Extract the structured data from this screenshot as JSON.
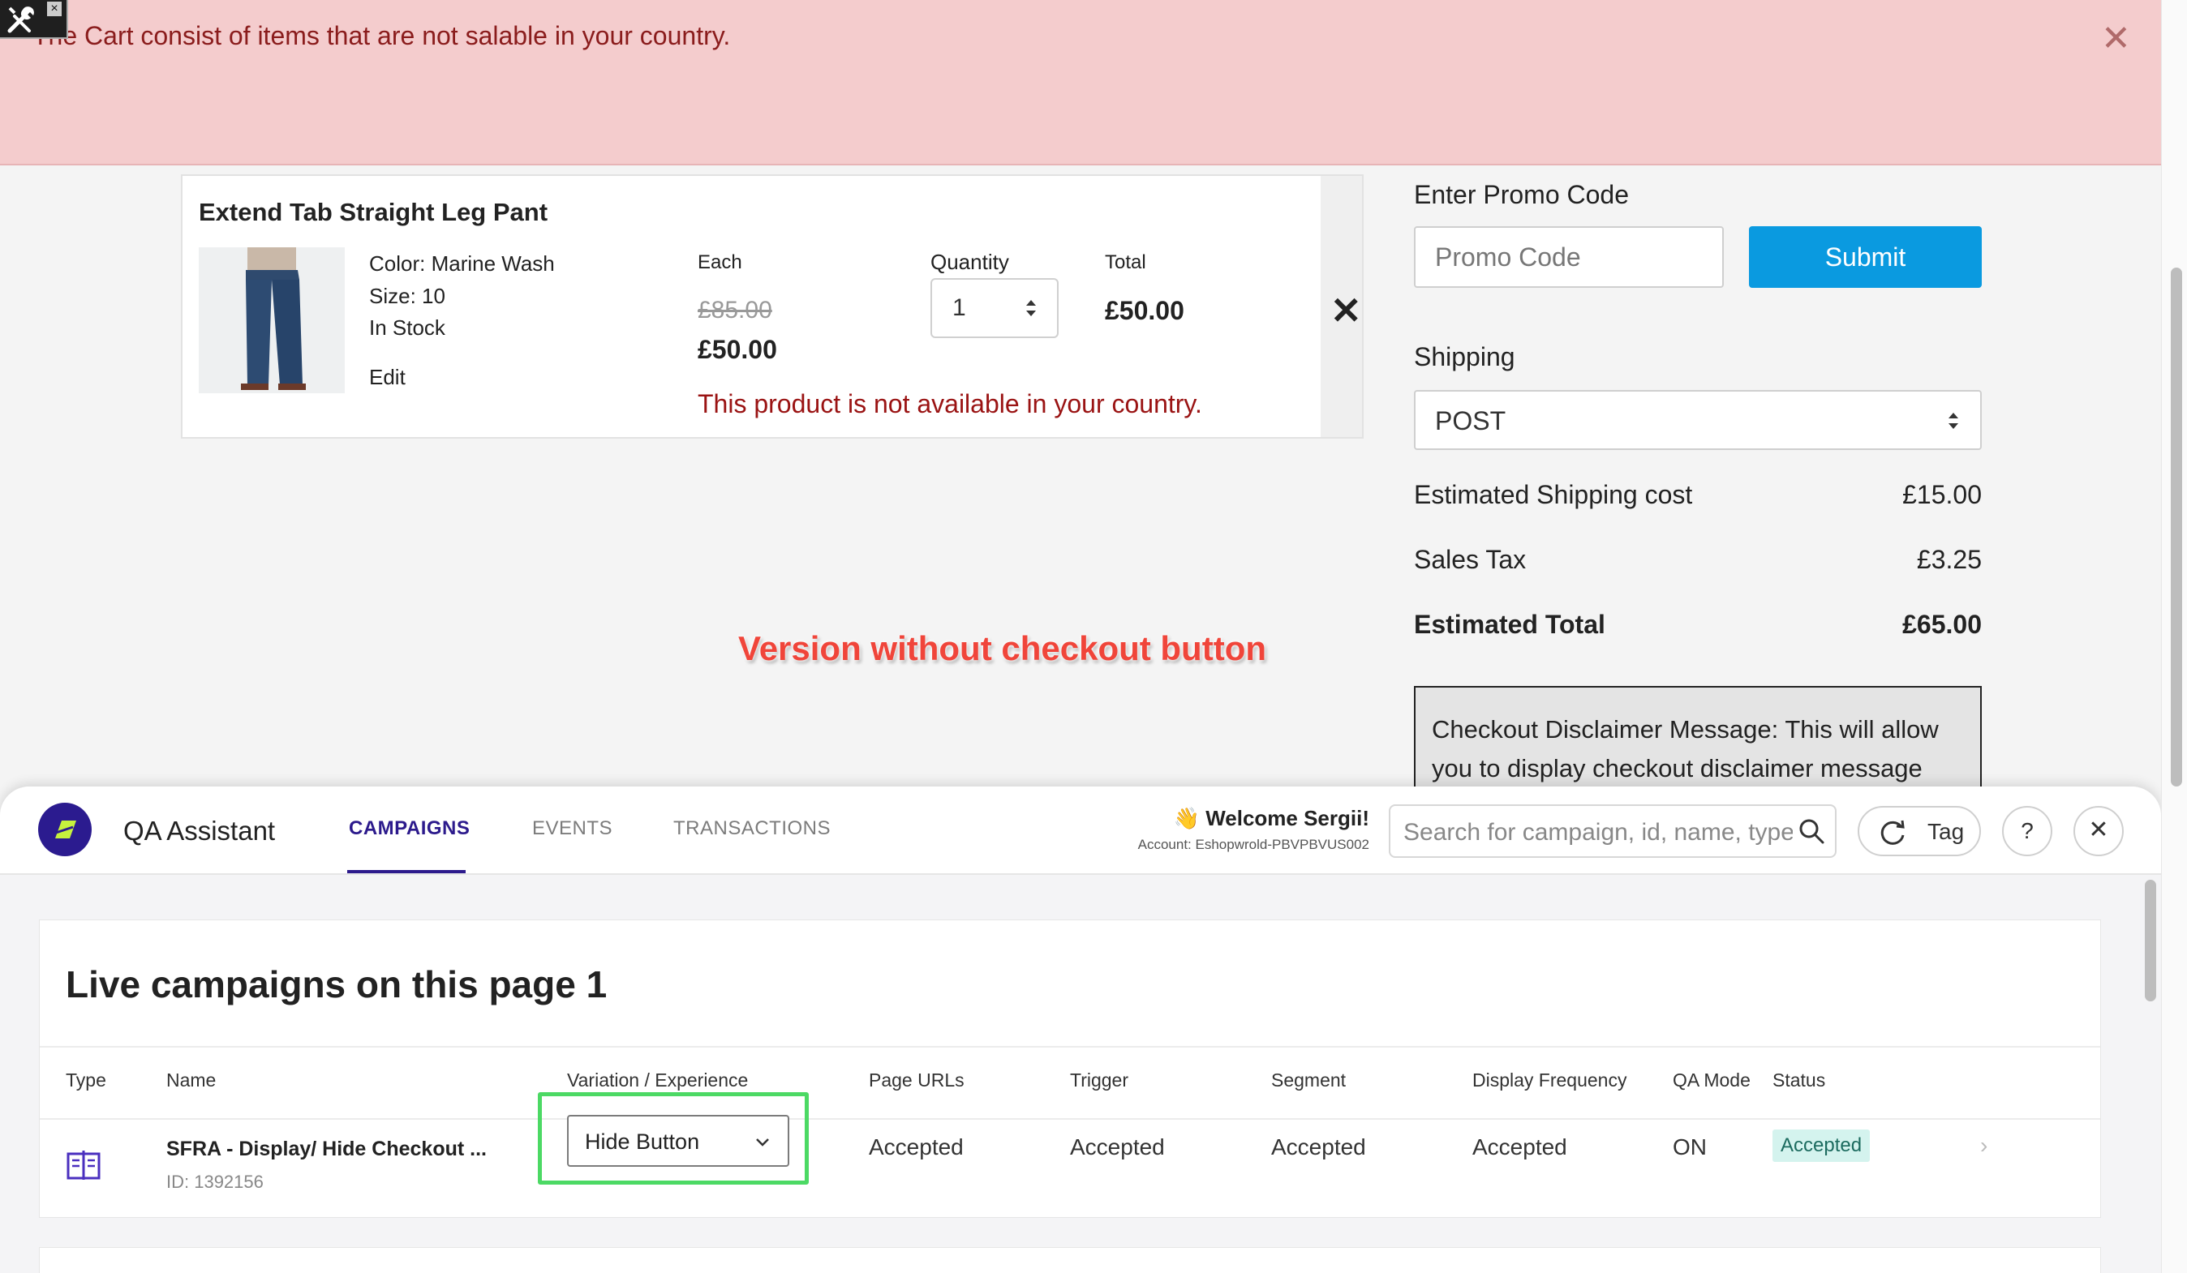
{
  "alert": {
    "message": "The Cart consist of items that are not salable in your country.",
    "close_glyph": "✕"
  },
  "cart": {
    "product_name": "Extend Tab Straight Leg Pant",
    "product_image_icon": "jeans-product-image",
    "color": "Color: Marine Wash",
    "size": "Size: 10",
    "stock": "In Stock",
    "edit_label": "Edit",
    "each_label": "Each",
    "quantity_label": "Quantity",
    "total_label": "Total",
    "price_original": "£85.00",
    "price_sale": "£50.00",
    "quantity_value": "1",
    "line_total": "£50.00",
    "remove_glyph": "✕",
    "availability_error": "This product is not available in your country."
  },
  "summary": {
    "promo_label": "Enter Promo Code",
    "promo_placeholder": "Promo Code",
    "submit_label": "Submit",
    "shipping_label": "Shipping",
    "shipping_value": "POST",
    "shipping_cost_label": "Estimated Shipping cost",
    "shipping_cost_value": "£15.00",
    "tax_label": "Sales Tax",
    "tax_value": "£3.25",
    "total_label": "Estimated Total",
    "total_value": "£65.00",
    "disclaimer": "Checkout Disclaimer Message: This will allow you to display checkout disclaimer message"
  },
  "annotation": "Version without checkout button",
  "qa": {
    "title": "QA Assistant",
    "tabs": [
      "CAMPAIGNS",
      "EVENTS",
      "TRANSACTIONS"
    ],
    "welcome": "👋 Welcome Sergii!",
    "account": "Account: Eshopwrold-PBVPBVUS002",
    "search_placeholder": "Search for campaign, id, name, type",
    "tag_label": "Tag",
    "help_label": "?",
    "close_glyph": "✕",
    "heading": "Live campaigns on this page 1",
    "columns": [
      "Type",
      "Name",
      "Variation / Experience",
      "Page URLs",
      "Trigger",
      "Segment",
      "Display Frequency",
      "QA Mode",
      "Status"
    ],
    "row": {
      "name": "SFRA - Display/ Hide Checkout ...",
      "id": "ID: 1392156",
      "variation": "Hide Button",
      "page_urls": "Accepted",
      "trigger": "Accepted",
      "segment": "Accepted",
      "frequency": "Accepted",
      "qa_mode": "ON",
      "status": "Accepted"
    }
  },
  "colors": {
    "alert_bg": "#f4cccd",
    "error_text": "#9a1313",
    "submit_bg": "#0a9ae0",
    "qa_accent": "#2c1a8c",
    "highlight": "#4cd964",
    "annotation": "#f0453a",
    "status_badge_bg": "#d4f3ee"
  }
}
